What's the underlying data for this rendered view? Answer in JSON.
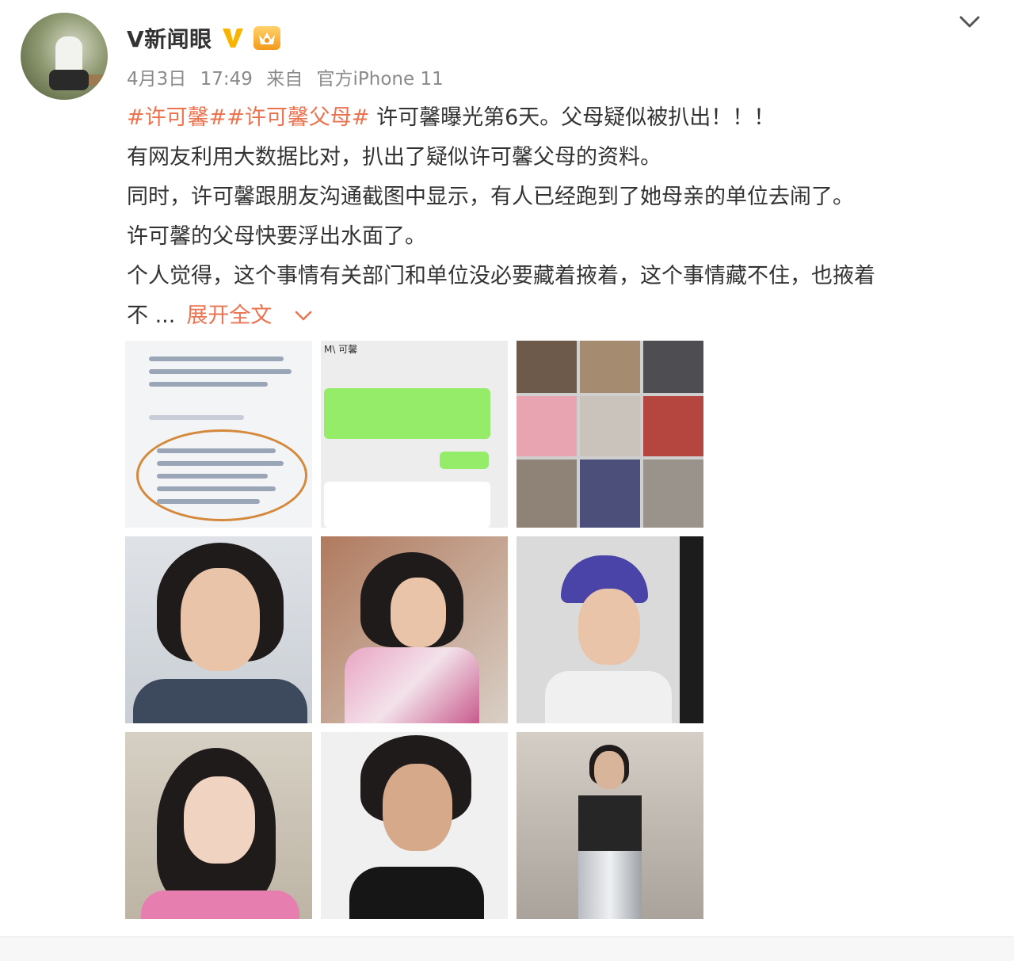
{
  "post": {
    "author": "V新闻眼",
    "date": "4月3日",
    "time": "17:49",
    "source_prefix": "来自",
    "source": "官方iPhone 11",
    "tags": [
      "#许可馨#",
      "#许可馨父母#"
    ],
    "headline": " 许可馨曝光第6天。父母疑似被扒出！！！",
    "lines": [
      "有网友利用大数据比对，扒出了疑似许可馨父母的资料。",
      "同时，许可馨跟朋友沟通截图中显示，有人已经跑到了她母亲的单位去闹了。",
      "许可馨的父母快要浮出水面了。",
      "个人觉得，这个事情有关部门和单位没必要藏着掖着，这个事情藏不住，也掖着"
    ],
    "truncated_tail": "不 ...",
    "expand_label": "展开全文"
  },
  "badges": {
    "verified": "V",
    "vip_text": "会员"
  },
  "colors": {
    "accent": "#eb7350",
    "verified": "#f7b500",
    "meta": "#8a8a8a"
  },
  "icons": {
    "expand": "chevron-down-icon",
    "menu": "chevron-down-icon"
  },
  "images": {
    "count": 9,
    "chat2_header": "M\\ 可馨"
  }
}
